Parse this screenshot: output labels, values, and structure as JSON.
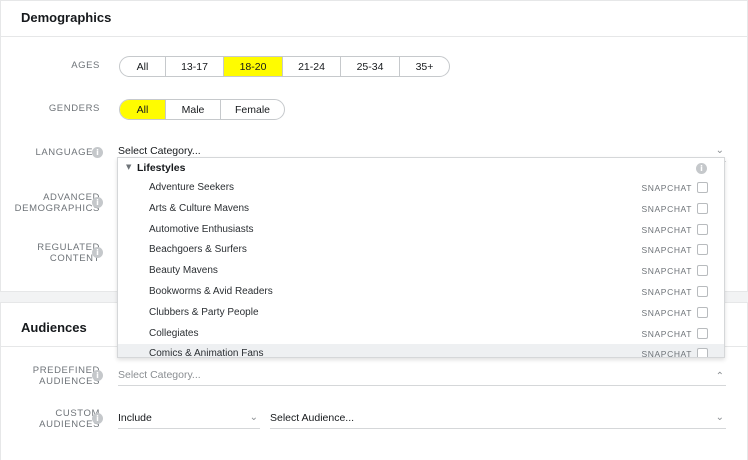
{
  "demographics": {
    "title": "Demographics",
    "ages": {
      "label": "AGES",
      "options": [
        "All",
        "13-17",
        "18-20",
        "21-24",
        "25-34",
        "35+"
      ],
      "selected": "18-20"
    },
    "genders": {
      "label": "GENDERS",
      "options": [
        "All",
        "Male",
        "Female"
      ],
      "selected": "All"
    },
    "languages": {
      "label": "LANGUAGES",
      "value": "Select Category..."
    },
    "advanced": {
      "label_line1": "ADVANCED",
      "label_line2": "DEMOGRAPHICS"
    },
    "regulated": {
      "label_line1": "REGULATED",
      "label_line2": "CONTENT"
    }
  },
  "dropdown": {
    "group": "Lifestyles",
    "items": [
      {
        "name": "Adventure Seekers",
        "source": "SNAPCHAT"
      },
      {
        "name": "Arts & Culture Mavens",
        "source": "SNAPCHAT"
      },
      {
        "name": "Automotive Enthusiasts",
        "source": "SNAPCHAT"
      },
      {
        "name": "Beachgoers & Surfers",
        "source": "SNAPCHAT"
      },
      {
        "name": "Beauty Mavens",
        "source": "SNAPCHAT"
      },
      {
        "name": "Bookworms & Avid Readers",
        "source": "SNAPCHAT"
      },
      {
        "name": "Clubbers & Party People",
        "source": "SNAPCHAT"
      },
      {
        "name": "Collegiates",
        "source": "SNAPCHAT"
      },
      {
        "name": "Comics & Animation Fans",
        "source": "SNAPCHAT"
      }
    ],
    "highlighted": "Comics & Animation Fans"
  },
  "audiences": {
    "title": "Audiences",
    "predefined": {
      "label_line1": "PREDEFINED",
      "label_line2": "AUDIENCES",
      "placeholder": "Select Category..."
    },
    "custom": {
      "label_line1": "CUSTOM",
      "label_line2": "AUDIENCES",
      "mode": "Include",
      "audience": "Select Audience..."
    }
  },
  "icons": {
    "info": "info-icon",
    "chevron": "chevron-down-icon",
    "chevron_up": "chevron-up-icon",
    "caret": "caret-down-icon"
  },
  "colors": {
    "accent_yellow": "#fffc00",
    "border": "#c6c9cc"
  }
}
